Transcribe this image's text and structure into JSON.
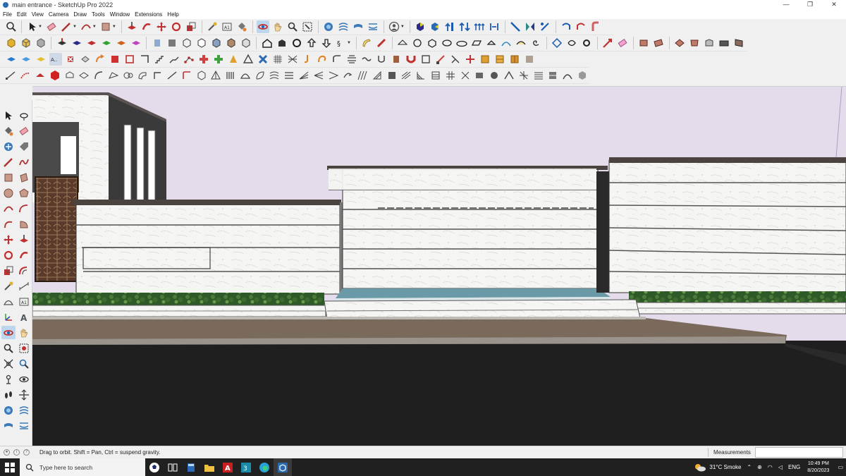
{
  "window": {
    "title": "main entrance - SketchUp Pro 2022",
    "controls": {
      "minimize": "—",
      "restore": "❐",
      "close": "✕"
    }
  },
  "menu": [
    "File",
    "Edit",
    "View",
    "Camera",
    "Draw",
    "Tools",
    "Window",
    "Extensions",
    "Help"
  ],
  "status": {
    "hint": "Drag to orbit. Shift = Pan, Ctrl = suspend gravity.",
    "measurements_label": "Measurements",
    "measurements_value": ""
  },
  "taskbar": {
    "search_placeholder": "Type here to search",
    "weather": "31°C  Smoke",
    "language": "ENG",
    "time": "10:49 PM",
    "date": "8/20/2023"
  },
  "colors": {
    "sky": "#e4dcea",
    "ground": "#1f1f1f",
    "path": "#7a6a5c",
    "hedge": "#2f5a2a",
    "wall": "#f4f4f2",
    "cap": "#4a4340"
  }
}
